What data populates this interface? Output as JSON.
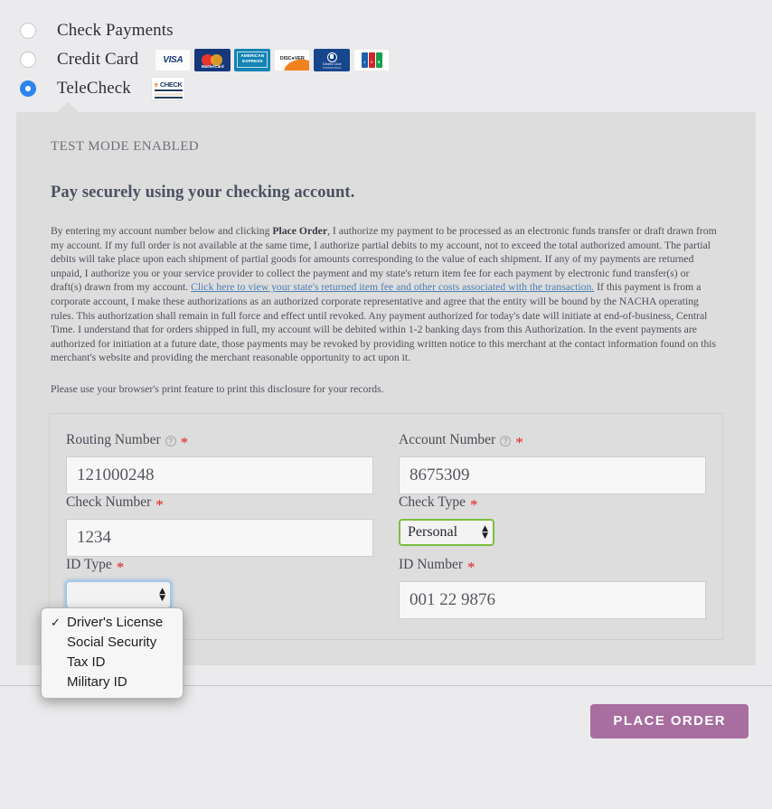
{
  "payment_methods": [
    {
      "id": "check-payments",
      "label": "Check Payments",
      "selected": false
    },
    {
      "id": "credit-card",
      "label": "Credit Card",
      "selected": false
    },
    {
      "id": "telecheck",
      "label": "TeleCheck",
      "selected": true
    }
  ],
  "card_logos": [
    {
      "name": "visa-logo",
      "text": "VISA"
    },
    {
      "name": "mastercard-logo",
      "text": "MasterCard"
    },
    {
      "name": "american-express-logo",
      "line1": "AMERICAN",
      "line2": "EXPRESS"
    },
    {
      "name": "discover-logo",
      "text": "DISC●VER"
    },
    {
      "name": "diners-club-logo",
      "line1": "Diners Club",
      "line2": "INTERNATIONAL"
    },
    {
      "name": "jcb-logo",
      "text": "JCB"
    }
  ],
  "echeck_logo": {
    "name": "echeck-logo",
    "e": "e",
    "check": "CHECK",
    "small": "— —"
  },
  "panel": {
    "test_mode": "TEST MODE ENABLED",
    "heading": "Pay securely using your checking account.",
    "disclosure_part1": "By entering my account number below and clicking ",
    "disclosure_bold": "Place Order",
    "disclosure_part2": ", I authorize my payment to be processed as an electronic funds transfer or draft drawn from my account. If my full order is not available at the same time, I authorize partial debits to my account, not to exceed the total authorized amount. The partial debits will take place upon each shipment of partial goods for amounts corresponding to the value of each shipment. If any of my payments are returned unpaid, I authorize you or your service provider to collect the payment and my state's return item fee for each payment by electronic fund transfer(s) or draft(s) drawn from my account. ",
    "disclosure_link": "Click here to view your state's returned item fee and other costs associated with the transaction.",
    "disclosure_part3": " If this payment is from a corporate account, I make these authorizations as an authorized corporate representative and agree that the entity will be bound by the NACHA operating rules. This authorization shall remain in full force and effect until revoked. Any payment authorized for today's date will initiate at end-of-business, Central Time. I understand that for orders shipped in full, my account will be debited within 1-2 banking days from this Authorization. In the event payments are authorized for initiation at a future date, those payments may be revoked by providing written notice to this merchant at the contact information found on this merchant's website and providing the merchant reasonable opportunity to act upon it.",
    "print_note": "Please use your browser's print feature to print this disclosure for your records."
  },
  "form": {
    "routing_number": {
      "label": "Routing Number",
      "help_icon": "?",
      "required_marker": "*",
      "value": "121000248"
    },
    "account_number": {
      "label": "Account Number",
      "help_icon": "?",
      "required_marker": "*",
      "value": "8675309"
    },
    "check_number": {
      "label": "Check Number",
      "required_marker": "*",
      "value": "1234"
    },
    "check_type": {
      "label": "Check Type",
      "required_marker": "*",
      "value": "Personal",
      "arrow_up": "▲",
      "arrow_down": "▼"
    },
    "id_type": {
      "label": "ID Type",
      "required_marker": "*",
      "value": "Driver's License",
      "arrow_up": "▲",
      "arrow_down": "▼",
      "open": true,
      "options": [
        {
          "label": "Driver's License",
          "checked": true
        },
        {
          "label": "Social Security",
          "checked": false
        },
        {
          "label": "Tax ID",
          "checked": false
        },
        {
          "label": "Military ID",
          "checked": false
        }
      ],
      "check_glyph": "✓"
    },
    "id_number": {
      "label": "ID Number",
      "required_marker": "*",
      "value": "001 22 9876"
    }
  },
  "footer": {
    "place_order_label": "PLACE ORDER"
  },
  "colors": {
    "page_background": "#ebeaec",
    "panel_background": "#dddddd",
    "radio_selected": "#2b85f0",
    "required_red": "#e02020",
    "link_blue": "#4a7fb5",
    "select_valid_green": "#7cbf3f",
    "select_focus_blue": "#6eafe8",
    "place_order_button": "#a86ea0"
  }
}
